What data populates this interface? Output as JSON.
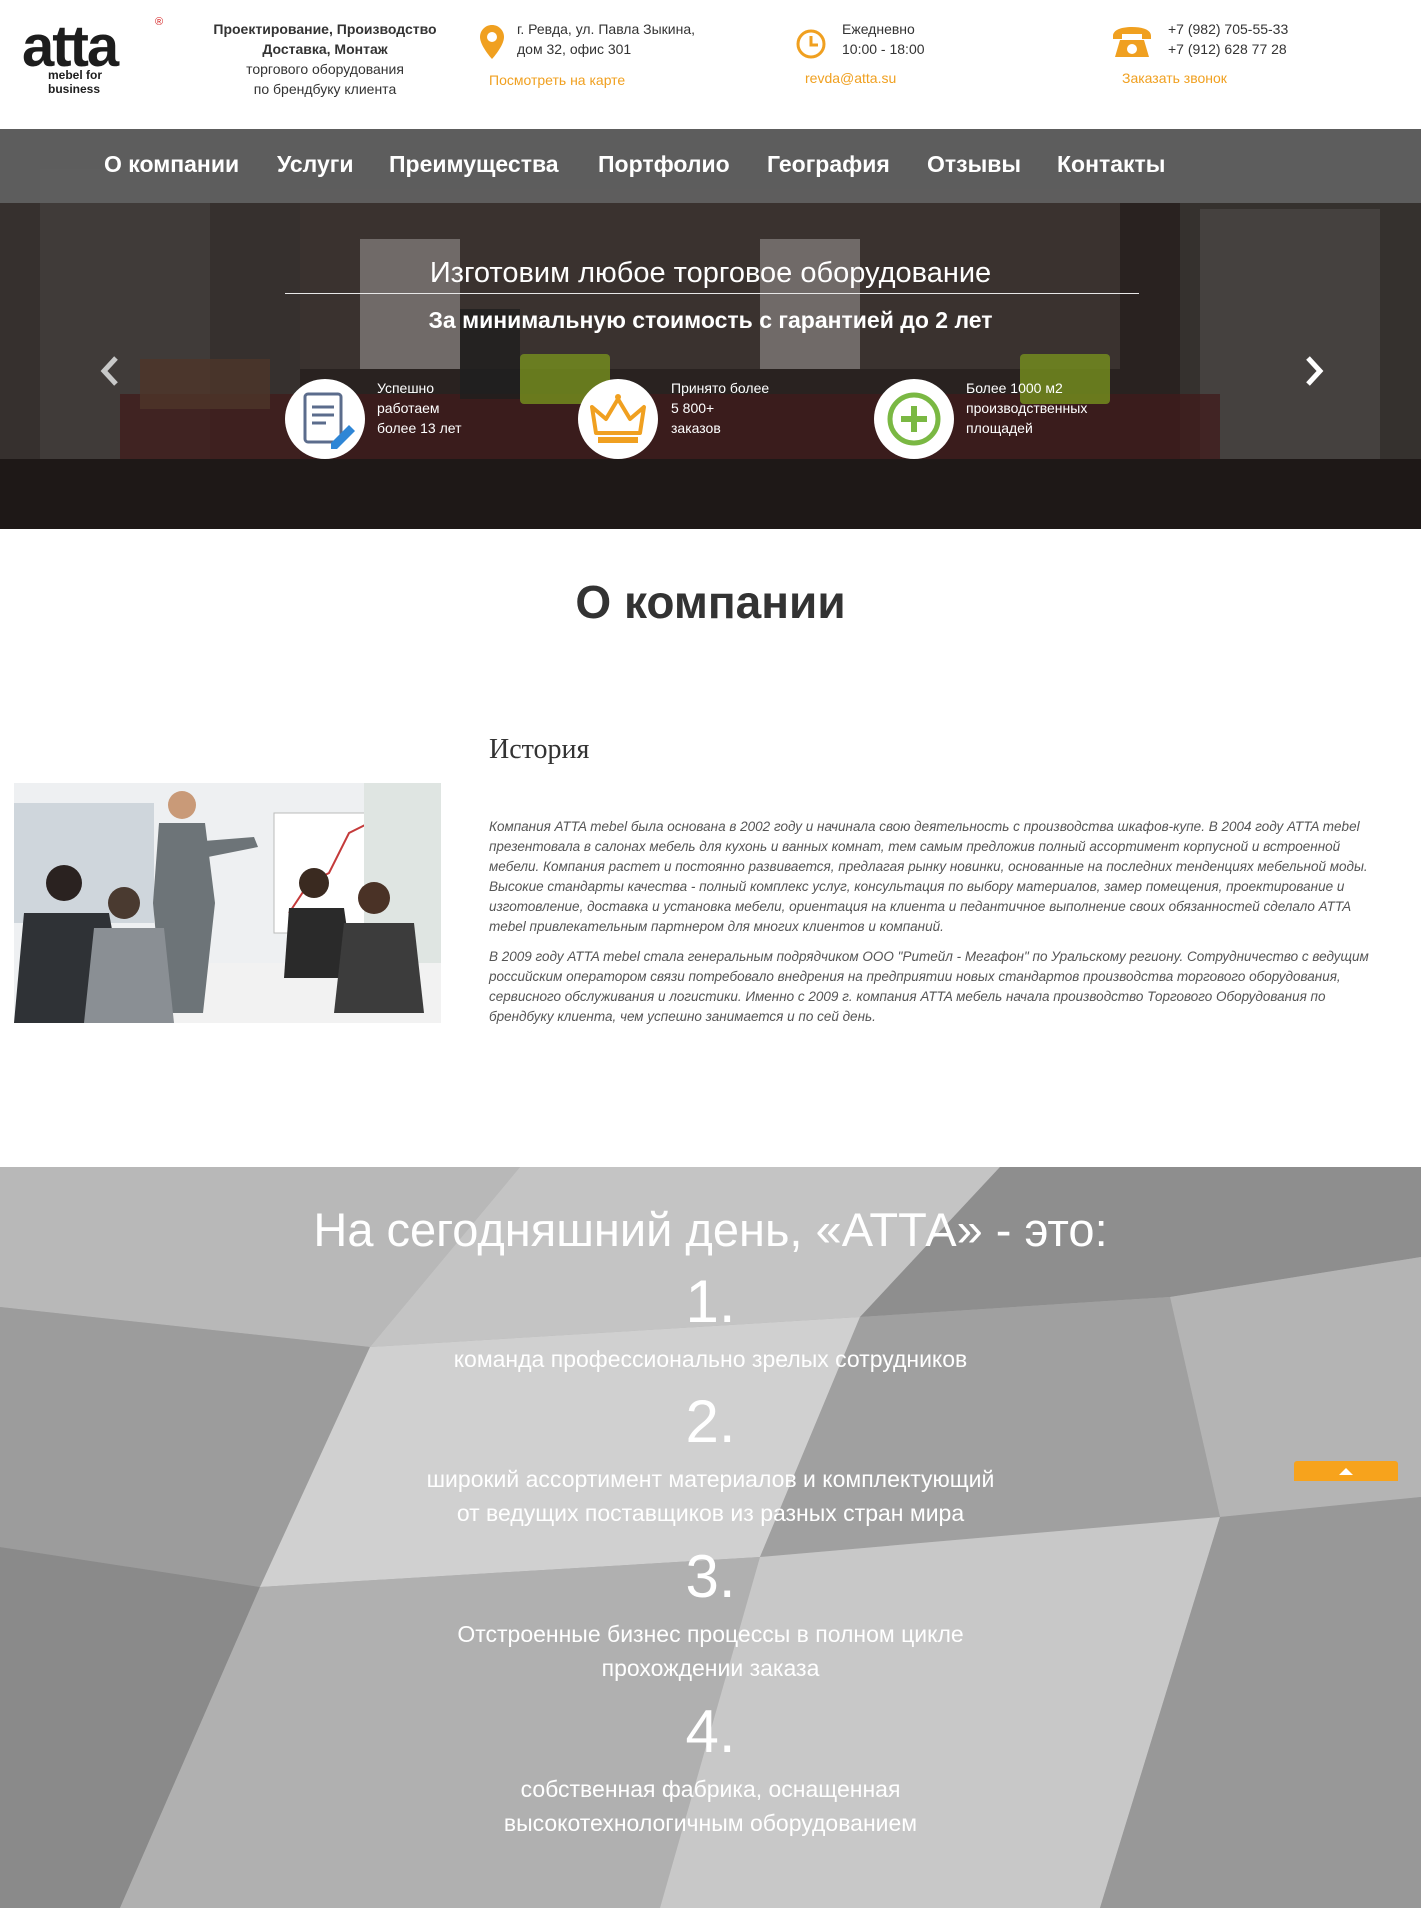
{
  "header": {
    "logo_text": "atta",
    "logo_tagline": "mebel for business",
    "logo_reg": "®",
    "desc_bold": "Проектирование, Производство Доставка, Монтаж",
    "desc_line1": "торгового оборудования",
    "desc_line2": "по брендбуку клиента",
    "address_line1": "г. Ревда, ул. Павла Зыкина,",
    "address_line2": "дом 32, офис 301",
    "map_link": "Посмотреть на карте",
    "hours_line1": "Ежедневно",
    "hours_line2": "10:00 - 18:00",
    "email": "revda@atta.su",
    "phone1": "+7 (982) 705-55-33",
    "phone2": "+7 (912) 628 77 28",
    "callback_link": "Заказать звонок"
  },
  "nav": [
    "О компании",
    "Услуги",
    "Преимущества",
    "Портфолио",
    "География",
    "Отзывы",
    "Контакты"
  ],
  "hero": {
    "title": "Изготовим любое торговое оборудование",
    "subtitle": "За минимальную стоимость с гарантией до 2 лет",
    "features": [
      {
        "icon": "document-pencil-icon",
        "lines": [
          "Успешно",
          "работаем",
          "более 13 лет"
        ]
      },
      {
        "icon": "crown-icon",
        "lines": [
          "Принято более",
          "5 800+",
          "заказов"
        ]
      },
      {
        "icon": "plus-circle-icon",
        "lines": [
          "Более 1000 м2",
          "производственных",
          "площадей"
        ]
      }
    ],
    "prev_arrow": "‹",
    "next_arrow": "›"
  },
  "about": {
    "title": "О компании",
    "history_title": "История",
    "paragraph1": "Компания ATTA mebel была основана в 2002 году и начинала свою деятельность с производства шкафов-купе. В 2004 году ATTA mebel презентовала в салонах мебель для кухонь и ванных комнат, тем самым предложив полный ассортимент корпусной и встроенной мебели. Компания растет и постоянно развивается, предлагая рынку новинки, основанные на последних тенденциях мебельной моды. Высокие стандарты качества - полный комплекс услуг, консультация по выбору материалов, замер помещения, проектирование и изготовление, доставка и установка мебели, ориентация на клиента и педантичное выполнение своих обязанностей сделало ATTA mebel привлекательным партнером для многих клиентов и компаний.",
    "paragraph2": "В 2009 году ATTA mebel стала генеральным подрядчиком ООО \"Ритейл - Мегафон\" по Уральскому региону. Сотрудничество с ведущим российским оператором связи потребовало внедрения на предприятии новых стандартов производства торгового оборудования, сервисного обслуживания и логистики. Именно с 2009 г. компания ATTA мебель начала производство Торгового Оборудования по брендбуку клиента, чем успешно занимается и по сей день."
  },
  "today": {
    "title": "На сегодняшний день, «АТТА» - это:",
    "items": [
      {
        "num": "1.",
        "line1": "команда профессионально зрелых сотрудников",
        "line2": ""
      },
      {
        "num": "2.",
        "line1": "широкий ассортимент материалов и комплектующий",
        "line2": "от ведущих поставщиков из разных стран мира"
      },
      {
        "num": "3.",
        "line1": "Отстроенные бизнес процессы в полном цикле",
        "line2": "прохождении заказа"
      },
      {
        "num": "4.",
        "line1": "собственная фабрика, оснащенная",
        "line2": "высокотехнологичным оборудованием"
      }
    ]
  },
  "colors": {
    "accent": "#f0a020",
    "nav_bg": "#5f5f5f",
    "plus_green": "#7ab843"
  }
}
